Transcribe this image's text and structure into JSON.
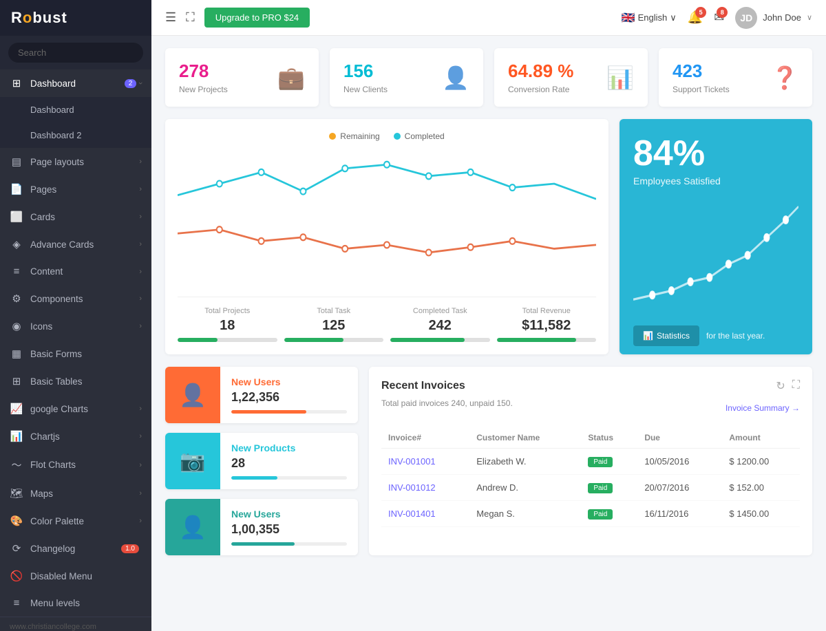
{
  "brand": {
    "name": "Robust",
    "name_styled": "R&#x14d;bust"
  },
  "sidebar": {
    "search_placeholder": "Search",
    "items": [
      {
        "id": "dashboard",
        "label": "Dashboard",
        "icon": "⊞",
        "badge": "2",
        "badge_type": "purple",
        "has_arrow": true,
        "expanded": true
      },
      {
        "id": "dashboard-1",
        "label": "Dashboard",
        "icon": "",
        "sub": true
      },
      {
        "id": "dashboard-2",
        "label": "Dashboard 2",
        "icon": "",
        "sub": true
      },
      {
        "id": "page-layouts",
        "label": "Page layouts",
        "icon": "▤",
        "has_arrow": true
      },
      {
        "id": "pages",
        "label": "Pages",
        "icon": "📄",
        "has_arrow": true
      },
      {
        "id": "cards",
        "label": "Cards",
        "icon": "⬜",
        "has_arrow": true
      },
      {
        "id": "advance-cards",
        "label": "Advance Cards",
        "icon": "◈",
        "has_arrow": true
      },
      {
        "id": "content",
        "label": "Content",
        "icon": "≡",
        "has_arrow": true
      },
      {
        "id": "components",
        "label": "Components",
        "icon": "⚙",
        "has_arrow": true
      },
      {
        "id": "icons",
        "label": "Icons",
        "icon": "◉",
        "has_arrow": true
      },
      {
        "id": "basic-forms",
        "label": "Basic Forms",
        "icon": "▦",
        "has_arrow": false
      },
      {
        "id": "basic-tables",
        "label": "Basic Tables",
        "icon": "⊞",
        "has_arrow": false
      },
      {
        "id": "google-charts",
        "label": "google Charts",
        "icon": "📈",
        "has_arrow": true
      },
      {
        "id": "chartjs",
        "label": "Chartjs",
        "icon": "📊",
        "has_arrow": true
      },
      {
        "id": "flot-charts",
        "label": "Flot Charts",
        "icon": "〜",
        "has_arrow": true
      },
      {
        "id": "maps",
        "label": "Maps",
        "icon": "🗺",
        "has_arrow": true
      },
      {
        "id": "color-palette",
        "label": "Color Palette",
        "icon": "🎨",
        "has_arrow": true
      },
      {
        "id": "changelog",
        "label": "Changelog",
        "icon": "⟳",
        "badge": "1.0",
        "badge_type": "red",
        "has_arrow": false
      },
      {
        "id": "disabled-menu",
        "label": "Disabled Menu",
        "icon": "🚫",
        "has_arrow": false
      },
      {
        "id": "menu-levels",
        "label": "Menu levels",
        "icon": "≡",
        "has_arrow": false
      }
    ],
    "footer_text": "www.christiancollege.com"
  },
  "topbar": {
    "menu_icon": "☰",
    "expand_icon": "⛶",
    "upgrade_label": "Upgrade to PRO $24",
    "language": "English",
    "notifications_count": "5",
    "messages_count": "8",
    "user_name": "John Doe",
    "user_initials": "JD"
  },
  "stats": [
    {
      "value": "278",
      "label": "New Projects",
      "icon": "💼",
      "color": "stat-pink"
    },
    {
      "value": "156",
      "label": "New Clients",
      "icon": "👤",
      "color": "stat-teal"
    },
    {
      "value": "64.89 %",
      "label": "Conversion Rate",
      "icon": "📊",
      "color": "stat-orange"
    },
    {
      "value": "423",
      "label": "Support Tickets",
      "icon": "❓",
      "color": "stat-blue"
    }
  ],
  "chart": {
    "legend": [
      {
        "label": "Remaining",
        "color": "#f5a623"
      },
      {
        "label": "Completed",
        "color": "#26c6da"
      }
    ],
    "stats": [
      {
        "label": "Total Projects",
        "value": "18",
        "progress": 40
      },
      {
        "label": "Total Task",
        "value": "125",
        "progress": 60
      },
      {
        "label": "Completed Task",
        "value": "242",
        "progress": 75
      },
      {
        "label": "Total Revenue",
        "value": "$11,582",
        "progress": 80
      }
    ]
  },
  "satisfaction": {
    "percentage": "84%",
    "label": "Employees Satisfied",
    "button_label": "Statistics",
    "description": "for the last year."
  },
  "widgets": [
    {
      "id": "new-users",
      "title": "New Users",
      "value": "1,22,356",
      "icon": "👤",
      "style": "orange",
      "progress": 65
    },
    {
      "id": "new-products",
      "title": "New Products",
      "value": "28",
      "icon": "📷",
      "style": "teal",
      "progress": 40
    },
    {
      "id": "new-users-2",
      "title": "New Users",
      "value": "1,00,355",
      "icon": "👤",
      "style": "green",
      "progress": 55
    }
  ],
  "invoices": {
    "title": "Recent Invoices",
    "subtext": "Total paid invoices 240, unpaid 150.",
    "summary_link": "Invoice Summary →",
    "columns": [
      "Invoice#",
      "Customer Name",
      "Status",
      "Due",
      "Amount"
    ],
    "rows": [
      {
        "id": "INV-001001",
        "customer": "Elizabeth W.",
        "status": "Paid",
        "due": "10/05/2016",
        "amount": "$ 1200.00"
      },
      {
        "id": "INV-001012",
        "customer": "Andrew D.",
        "status": "Paid",
        "due": "20/07/2016",
        "amount": "$ 152.00"
      },
      {
        "id": "INV-001401",
        "customer": "Megan S.",
        "status": "Paid",
        "due": "16/11/2016",
        "amount": "$ 1450.00"
      }
    ]
  }
}
